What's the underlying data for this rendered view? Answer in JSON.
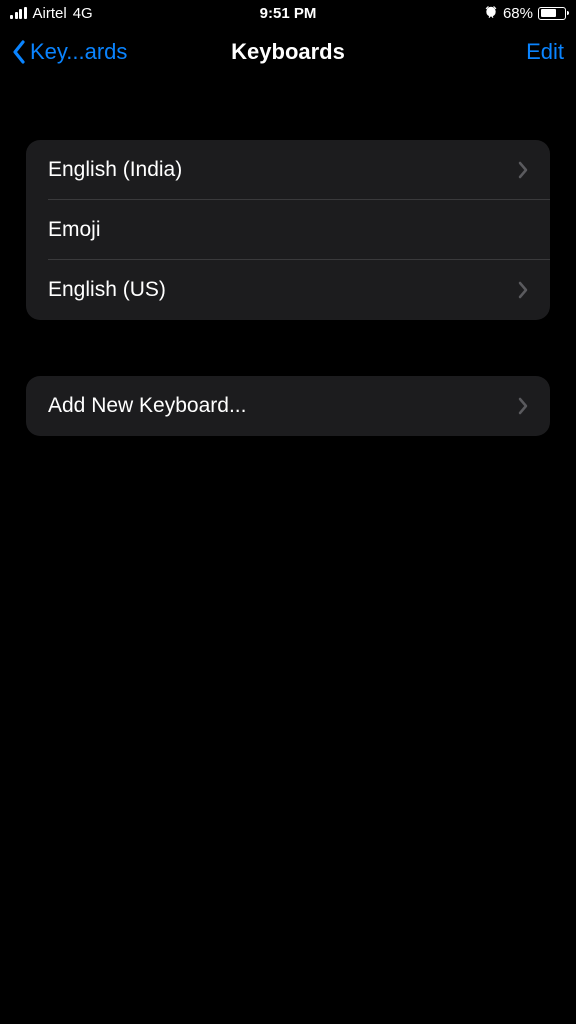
{
  "status": {
    "carrier": "Airtel",
    "network": "4G",
    "time": "9:51 PM",
    "battery_percent": "68%",
    "battery_level": 68
  },
  "nav": {
    "back_label": "Key...ards",
    "title": "Keyboards",
    "edit": "Edit"
  },
  "keyboards": [
    {
      "label": "English (India)",
      "disclosure": true
    },
    {
      "label": "Emoji",
      "disclosure": false
    },
    {
      "label": "English (US)",
      "disclosure": true
    }
  ],
  "add": {
    "label": "Add New Keyboard..."
  }
}
